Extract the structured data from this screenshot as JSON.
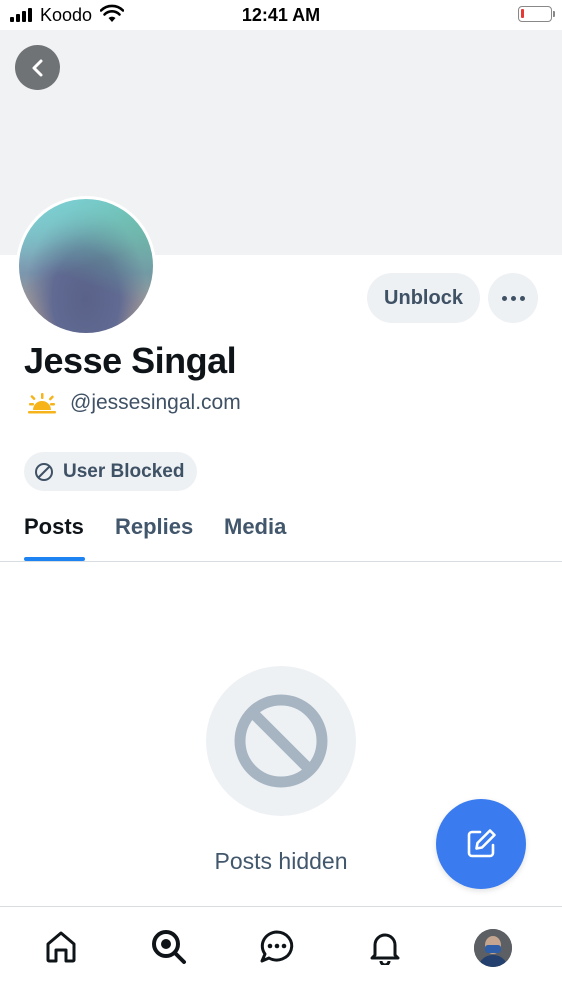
{
  "status_bar": {
    "carrier": "Koodo",
    "time": "12:41 AM",
    "battery_level": 0.1,
    "battery_color": "#e53935"
  },
  "profile": {
    "display_name": "Jesse Singal",
    "handle": "@jessesingal.com",
    "handle_icon": "sunrise-emoji-icon",
    "unblock_label": "Unblock",
    "blocked_label": "User Blocked"
  },
  "tabs": [
    {
      "label": "Posts",
      "active": true
    },
    {
      "label": "Replies",
      "active": false
    },
    {
      "label": "Media",
      "active": false
    }
  ],
  "empty_state": {
    "icon": "ban-icon",
    "label": "Posts hidden"
  },
  "fab": {
    "icon": "compose-icon",
    "color": "#3a7cf0"
  },
  "bottom_nav": [
    {
      "name": "home",
      "icon": "home-icon"
    },
    {
      "name": "search",
      "icon": "search-icon"
    },
    {
      "name": "chat",
      "icon": "chat-icon"
    },
    {
      "name": "notifications",
      "icon": "bell-icon"
    },
    {
      "name": "profile",
      "icon": "avatar"
    }
  ],
  "colors": {
    "accent": "#1d83f2",
    "muted_text": "#42576c",
    "pill_bg": "#eef1f4"
  }
}
